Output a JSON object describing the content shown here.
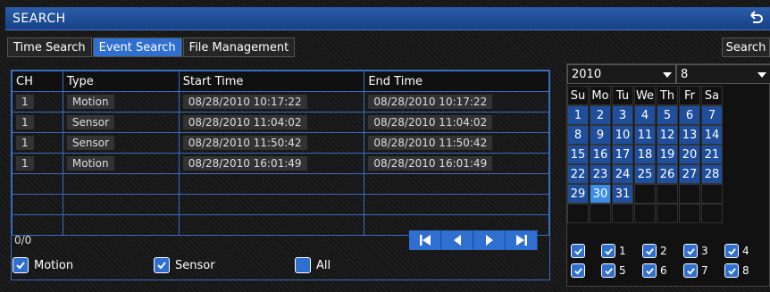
{
  "window": {
    "title": "SEARCH"
  },
  "tabs": [
    {
      "label": "Time Search",
      "active": false
    },
    {
      "label": "Event Search",
      "active": true
    },
    {
      "label": "File Management",
      "active": false
    }
  ],
  "search_button": "Search",
  "table": {
    "headers": [
      "CH",
      "Type",
      "Start Time",
      "End Time"
    ],
    "rows": [
      [
        "1",
        "Motion",
        "08/28/2010  10:17:22",
        "08/28/2010  10:17:22"
      ],
      [
        "1",
        "Sensor",
        "08/28/2010 11:04:02",
        "08/28/2010 11:04:02"
      ],
      [
        "1",
        "Sensor",
        "08/28/2010 11:50:42",
        "08/28/2010 11:50:42"
      ],
      [
        "1",
        "Motion",
        "08/28/2010 16:01:49",
        "08/28/2010 16:01:49"
      ]
    ]
  },
  "count": "0/0",
  "filters": [
    {
      "label": "Motion",
      "checked": true
    },
    {
      "label": "Sensor",
      "checked": true
    },
    {
      "label": "All",
      "checked": false
    }
  ],
  "calendar": {
    "year": "2010",
    "month": "8",
    "weekdays": [
      "Su",
      "Mo",
      "Tu",
      "We",
      "Th",
      "Fr",
      "Sa"
    ],
    "weeks": [
      [
        "1",
        "2",
        "3",
        "4",
        "5",
        "6",
        "7"
      ],
      [
        "8",
        "9",
        "10",
        "11",
        "12",
        "13",
        "14"
      ],
      [
        "15",
        "16",
        "17",
        "18",
        "19",
        "20",
        "21"
      ],
      [
        "22",
        "23",
        "24",
        "25",
        "26",
        "27",
        "28"
      ],
      [
        "29",
        "30",
        "31",
        "",
        "",
        "",
        ""
      ],
      [
        "",
        "",
        "",
        "",
        "",
        "",
        ""
      ]
    ],
    "selected_day": "30"
  },
  "channels": [
    "1",
    "2",
    "3",
    "4",
    "5",
    "6",
    "7",
    "8"
  ],
  "colors": {
    "accent": "#2f6fd0",
    "title_bar": "#174088",
    "border": "#3a6cc0"
  }
}
